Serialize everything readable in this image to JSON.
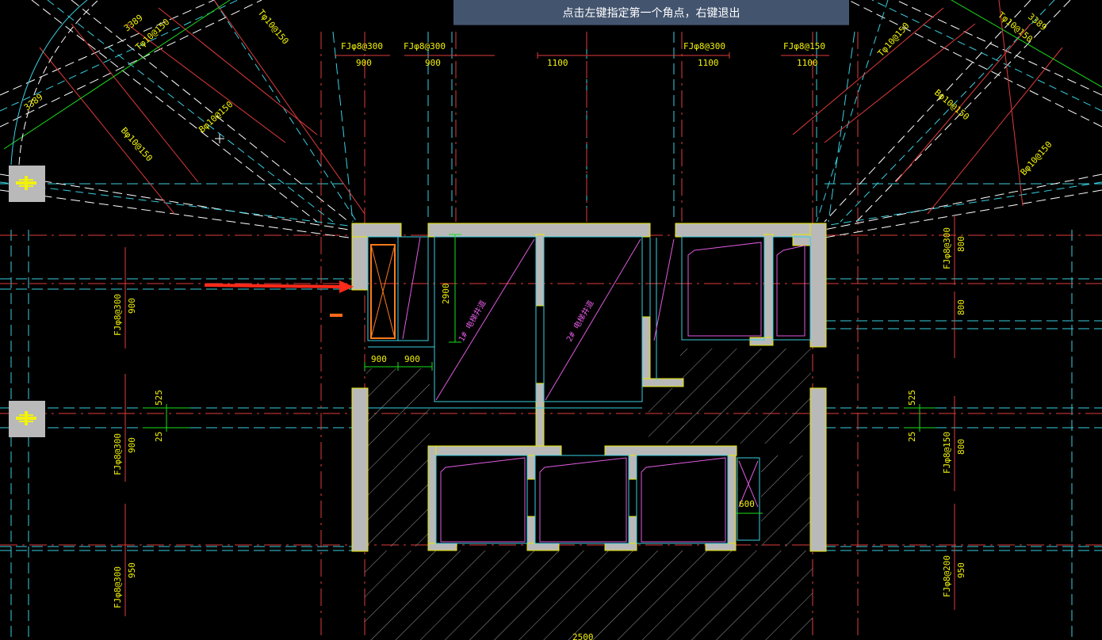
{
  "status_prompt": "点击左键指定第一个角点，右键退出",
  "rebar_labels": {
    "fj8_300_a": "FJφ8@300",
    "fj8_300_b": "FJφ8@300",
    "fj8_300_c": "FJφ8@300",
    "fj8_150_top": "FJφ8@150",
    "fj8_300_left1": "FJφ8@300",
    "fj8_300_left2": "FJφ8@300",
    "fj8_300_left3": "FJφ8@300",
    "fj8_300_right": "FJφ8@300",
    "fj8_150_right": "FJφ8@150",
    "fj8_200_right": "FJφ8@200",
    "t10_150_a": "Tφ10@150",
    "t10_150_b": "Tφ10@150",
    "t10_150_c": "Tφ10@150",
    "t10_150_d": "Tφ10@150",
    "b10_150_a": "Bφ10@150",
    "b10_150_b": "Bφ10@150",
    "b10_150_c": "Bφ10@150",
    "b10_150_d": "Bφ10@150"
  },
  "dimensions": {
    "d3389_a": "3389",
    "d3389_b": "3389",
    "d3389_c": "3389",
    "top_900_a": "900",
    "top_900_b": "900",
    "top_1100_a": "1100",
    "top_1100_b": "1100",
    "top_1100_c": "1100",
    "left_900_a": "900",
    "left_900_b": "900",
    "left_950": "950",
    "left_525": "525",
    "left_25": "25",
    "right_800_a": "800",
    "right_800_b": "800",
    "right_800_c": "800",
    "right_950": "950",
    "right_525": "525",
    "right_25": "25",
    "v2900": "2900",
    "room_900_a": "900",
    "room_900_b": "900",
    "room_600": "600",
    "bottom_2500": "2500"
  },
  "room_tags": {
    "pit1": "1# 电梯井道",
    "pit2": "2# 电梯井道"
  },
  "colors": {
    "wall": "#b9b9b9",
    "red_line": "#e03b3b",
    "cyan_line": "#38d0e0",
    "magenta": "#e05ae0",
    "yellow_text": "#f2f20a",
    "green_dim": "#19e019",
    "white_line": "#ffffff",
    "orange_select": "#ff7a1a",
    "arrow": "#ff2a1a",
    "prompt_bg": "#43546f"
  },
  "icons": {
    "column_marker": "column-grip-icon",
    "cursor": "crosshair-cursor-icon",
    "arrow": "pointer-arrow-icon"
  }
}
